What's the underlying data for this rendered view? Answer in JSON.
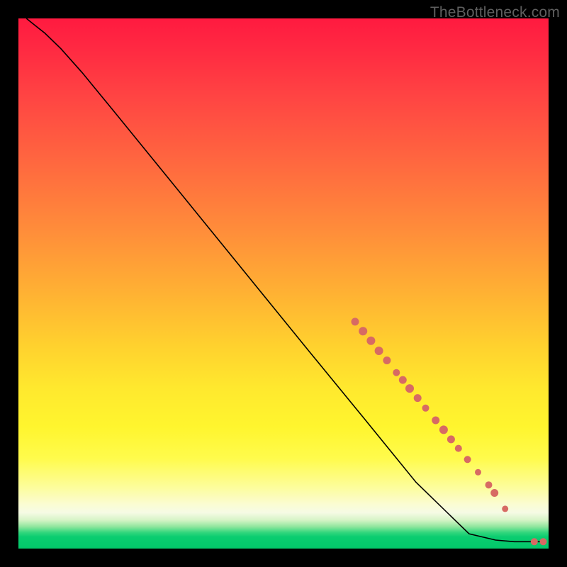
{
  "watermark": "TheBottleneck.com",
  "colors": {
    "marker": "#d76a63",
    "curve": "#000000"
  },
  "chart_data": {
    "type": "line",
    "title": "",
    "xlabel": "",
    "ylabel": "",
    "xlim": [
      0,
      100
    ],
    "ylim": [
      0,
      100
    ],
    "curve": [
      {
        "x": 1.5,
        "y": 100
      },
      {
        "x": 3.0,
        "y": 98.8
      },
      {
        "x": 5.0,
        "y": 97.2
      },
      {
        "x": 8.0,
        "y": 94.3
      },
      {
        "x": 12.0,
        "y": 89.8
      },
      {
        "x": 18.0,
        "y": 82.5
      },
      {
        "x": 25.0,
        "y": 73.9
      },
      {
        "x": 35.0,
        "y": 61.6
      },
      {
        "x": 45.0,
        "y": 49.3
      },
      {
        "x": 55.0,
        "y": 37.0
      },
      {
        "x": 65.0,
        "y": 24.8
      },
      {
        "x": 75.0,
        "y": 12.5
      },
      {
        "x": 85.0,
        "y": 2.8
      },
      {
        "x": 90.0,
        "y": 1.6
      },
      {
        "x": 93.5,
        "y": 1.3
      },
      {
        "x": 97.0,
        "y": 1.3
      },
      {
        "x": 99.0,
        "y": 1.3
      }
    ],
    "markers": [
      {
        "x": 63.5,
        "y": 42.8,
        "r": 5.5
      },
      {
        "x": 65.0,
        "y": 41.0,
        "r": 6.0
      },
      {
        "x": 66.5,
        "y": 39.2,
        "r": 6.0
      },
      {
        "x": 68.0,
        "y": 37.3,
        "r": 6.0
      },
      {
        "x": 69.5,
        "y": 35.5,
        "r": 5.5
      },
      {
        "x": 71.3,
        "y": 33.2,
        "r": 5.0
      },
      {
        "x": 72.5,
        "y": 31.8,
        "r": 5.5
      },
      {
        "x": 73.8,
        "y": 30.2,
        "r": 6.0
      },
      {
        "x": 75.3,
        "y": 28.4,
        "r": 5.5
      },
      {
        "x": 76.8,
        "y": 26.5,
        "r": 5.0
      },
      {
        "x": 78.7,
        "y": 24.2,
        "r": 5.5
      },
      {
        "x": 80.2,
        "y": 22.4,
        "r": 6.0
      },
      {
        "x": 81.6,
        "y": 20.6,
        "r": 5.5
      },
      {
        "x": 83.0,
        "y": 18.9,
        "r": 5.0
      },
      {
        "x": 84.7,
        "y": 16.8,
        "r": 5.0
      },
      {
        "x": 86.7,
        "y": 14.4,
        "r": 4.5
      },
      {
        "x": 88.7,
        "y": 12.0,
        "r": 5.0
      },
      {
        "x": 89.8,
        "y": 10.5,
        "r": 5.5
      },
      {
        "x": 91.8,
        "y": 7.5,
        "r": 4.5
      },
      {
        "x": 97.3,
        "y": 1.3,
        "r": 5.0
      },
      {
        "x": 99.0,
        "y": 1.3,
        "r": 5.0
      }
    ]
  }
}
